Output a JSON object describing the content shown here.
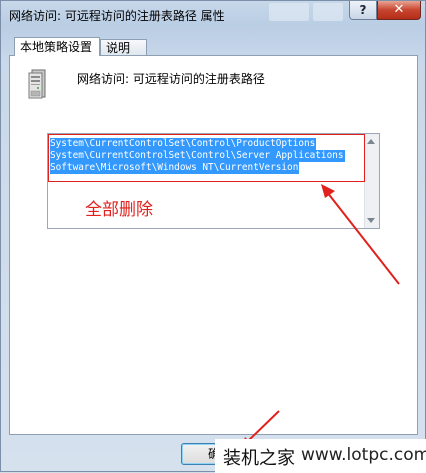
{
  "window": {
    "title": "网络访问: 可远程访问的注册表路径 属性",
    "help_label": "?",
    "close_label": "✕"
  },
  "tabs": [
    {
      "label": "本地策略设置",
      "active": true
    },
    {
      "label": "说明",
      "active": false
    }
  ],
  "policy": {
    "icon": "server-icon",
    "name": "网络访问: 可远程访问的注册表路径"
  },
  "registry_paths": [
    "System\\CurrentControlSet\\Control\\ProductOptions",
    "System\\CurrentControlSet\\Control\\Server Applications",
    "Software\\Microsoft\\Windows NT\\CurrentVersion"
  ],
  "annotation": {
    "text": "全部删除",
    "color": "#e0211c"
  },
  "buttons": {
    "ok_label": "确定"
  },
  "watermark": {
    "cn": "装机之家",
    "en": "www.lotpc.com"
  },
  "colors": {
    "selection": "#3399ff",
    "annotation_red": "#e0211c",
    "close_red": "#c7452e"
  }
}
